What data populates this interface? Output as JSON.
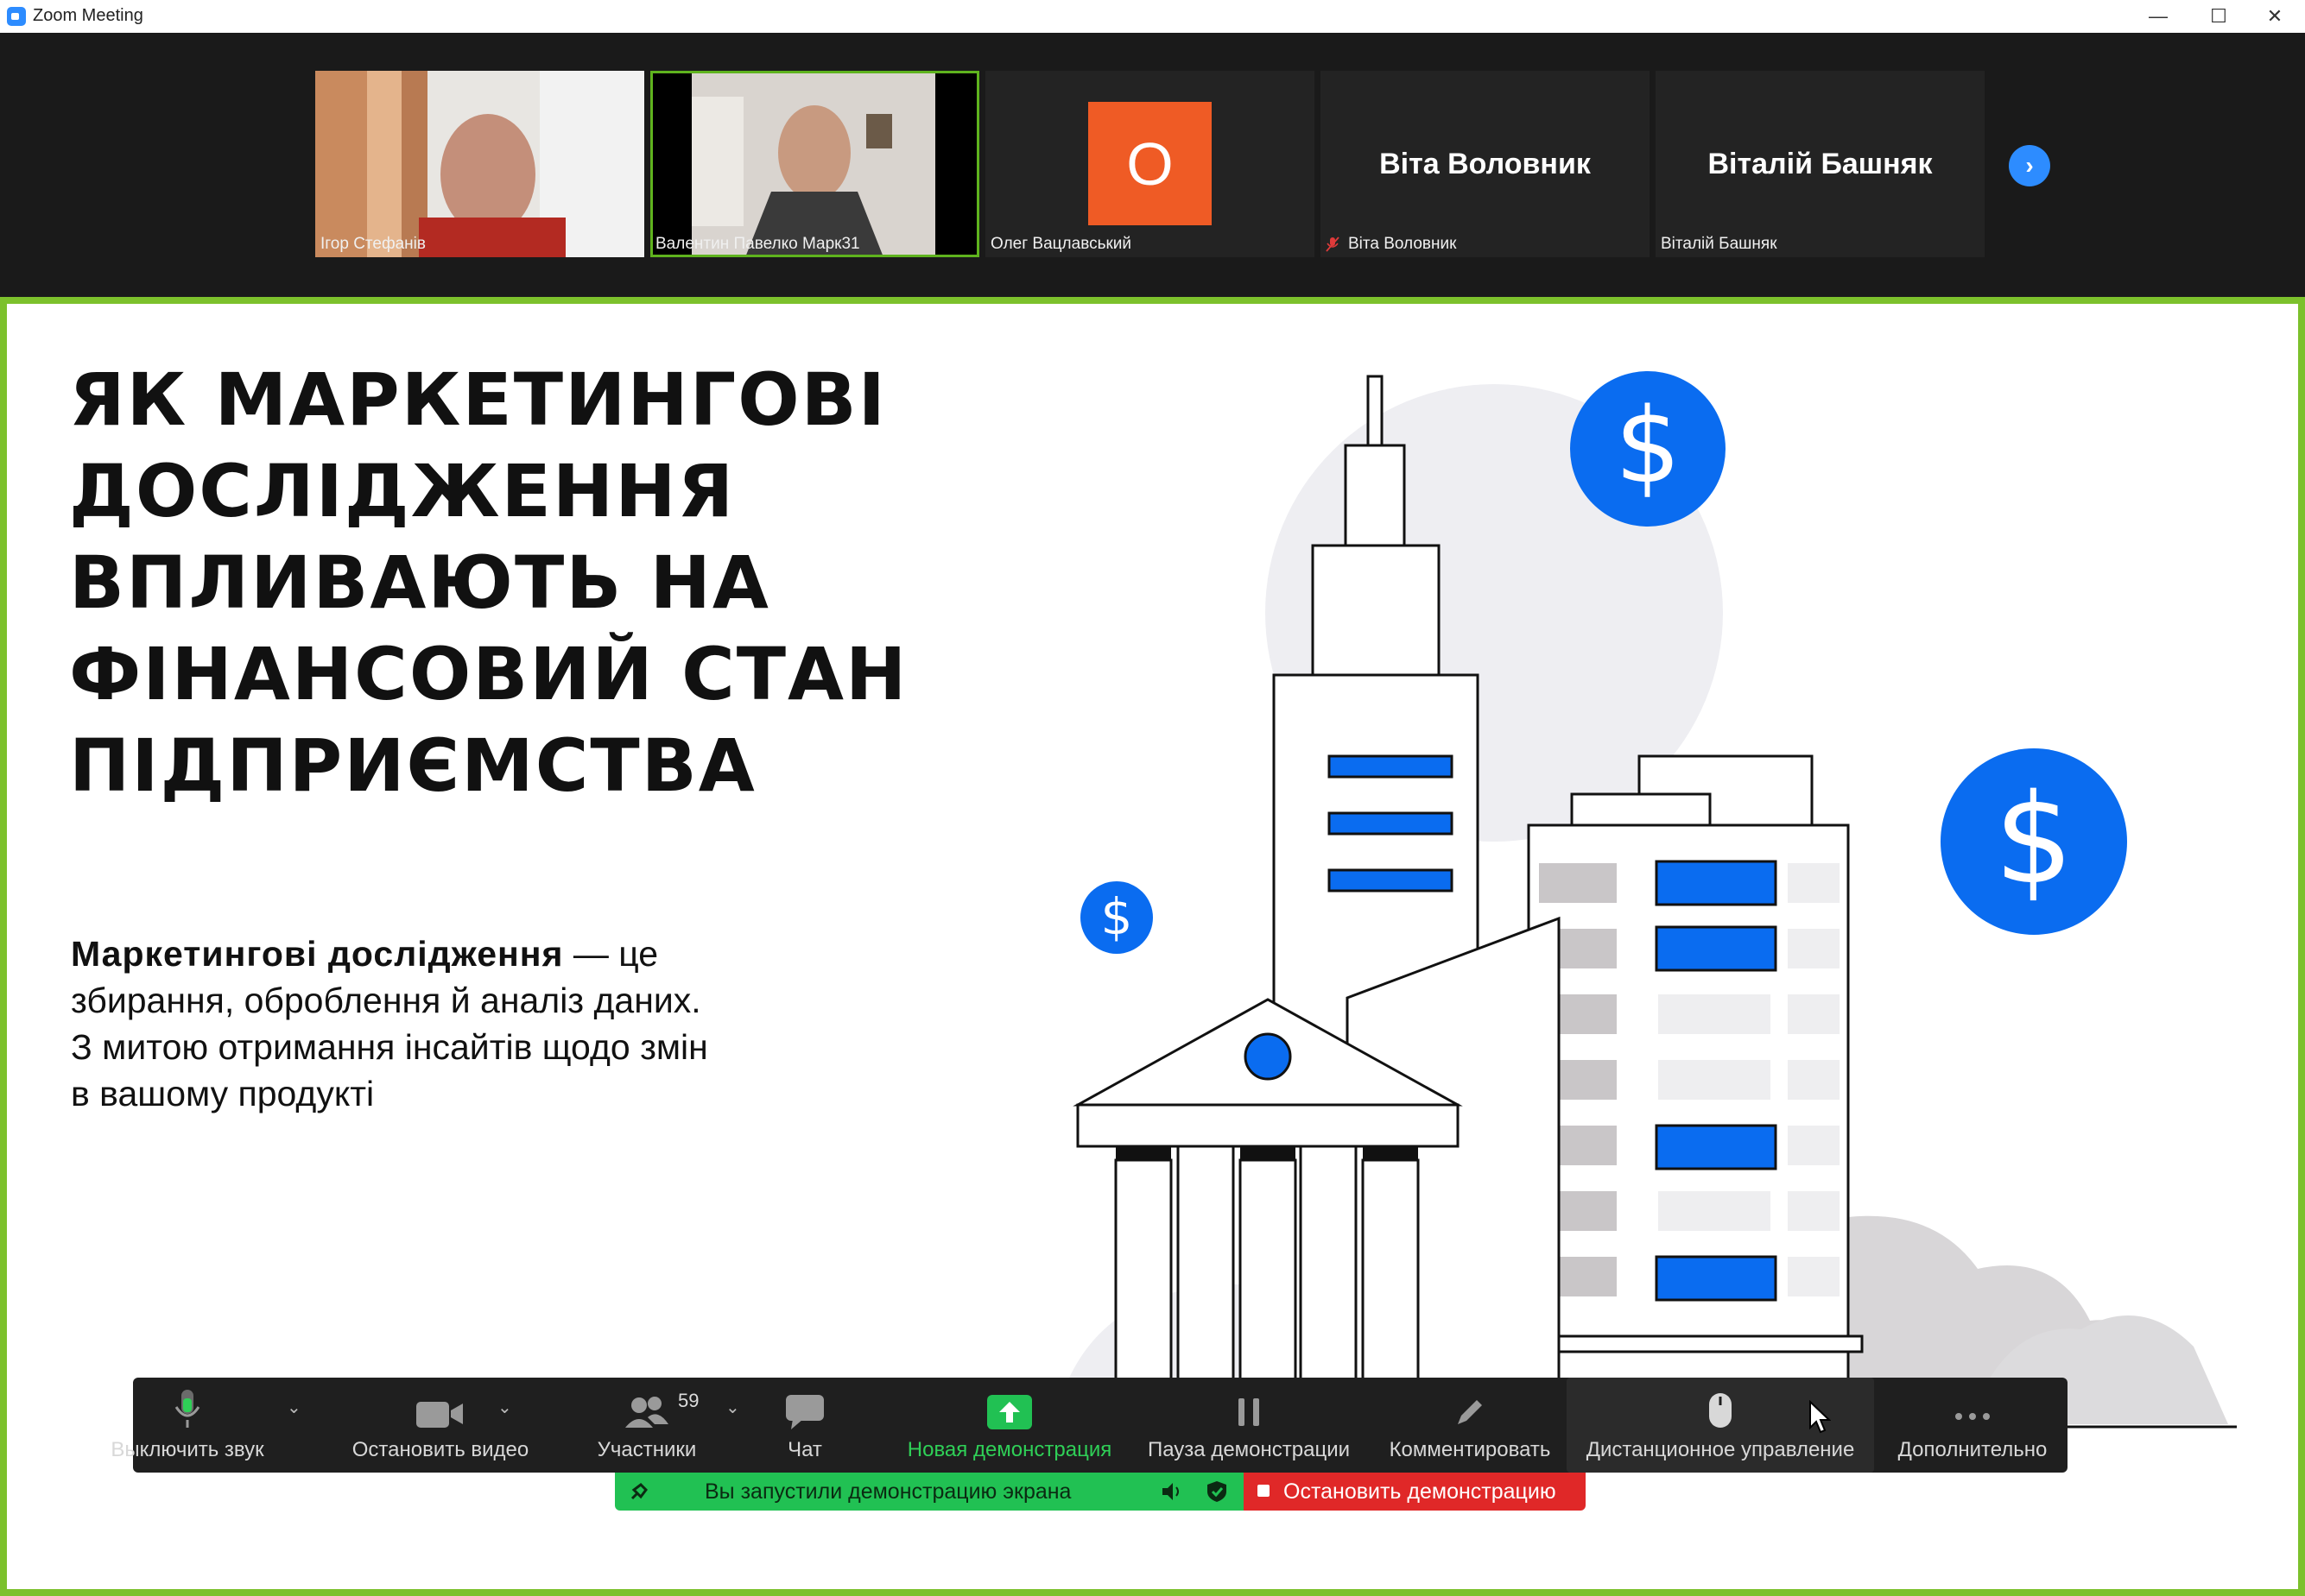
{
  "window": {
    "title": "Zoom Meeting",
    "minimize": "—",
    "maximize": "☐",
    "close": "✕"
  },
  "participants": [
    {
      "name": "Ігор Стефанів",
      "type": "video"
    },
    {
      "name": "Валентин Павелко Марк31",
      "type": "video",
      "speaking": true
    },
    {
      "name": "Олег Вацлавський",
      "type": "avatar",
      "initial": "О",
      "avatar_color": "#ef5b25"
    },
    {
      "name": "Віта Воловник",
      "display": "Віта Воловник",
      "type": "name",
      "muted": true
    },
    {
      "name": "Віталій Башняк",
      "display": "Віталій Башняк",
      "type": "name"
    }
  ],
  "next_page_icon": "chevron-right-icon",
  "slide": {
    "title_lines": [
      "ЯК МАРКЕТИНГОВІ",
      "ДОСЛІДЖЕННЯ",
      "ВПЛИВАЮТЬ НА",
      "ФІНАНСОВИЙ СТАН",
      "ПІДПРИЄМСТВА"
    ],
    "body_bold": "Маркетингові дослідження",
    "body_rest_1": " — це",
    "body_lines": [
      "збирання, оброблення й аналіз даних.",
      "З митою отримання інсайтів щодо змін",
      "в вашому продукті"
    ],
    "dollar_symbol": "$",
    "accent_color": "#0a6cf0"
  },
  "toolbar": {
    "mute": "Выключить звук",
    "video": "Остановить видео",
    "participants": "Участники",
    "participants_count": "59",
    "chat": "Чат",
    "new_share": "Новая демонстрация",
    "pause_share": "Пауза демонстрации",
    "annotate": "Комментировать",
    "remote_control": "Дистанционное управление",
    "more": "Дополнительно"
  },
  "share_status": {
    "text": "Вы запустили демонстрацию экрана",
    "stop": "Остановить демонстрацию"
  },
  "colors": {
    "share_border": "#7cc12c",
    "status_green": "#21c153",
    "stop_red": "#e02828"
  }
}
